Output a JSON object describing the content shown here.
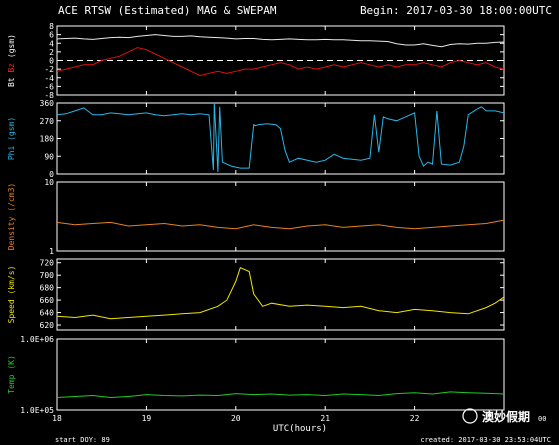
{
  "header": {
    "title": "ACE RTSW (Estimated) MAG & SWEPAM",
    "begin": "Begin: 2017-03-30 18:00:00UTC"
  },
  "footer": {
    "start": "start DOY: 89",
    "created": "created: 2017-03-30 23:53:04UTC",
    "xlabel": "UTC(hours)"
  },
  "watermark": {
    "text": "澳妙假期",
    "suffix": "00"
  },
  "chart_data": [
    {
      "type": "line",
      "panel": "mag",
      "ylabel_parts": [
        {
          "text": "Bt",
          "color": "#ffffff"
        },
        {
          "text": "Bz",
          "color": "#ff2020"
        },
        {
          "text": "(gsm)",
          "color": "#ffffff"
        }
      ],
      "yticks": [
        "-8",
        "-6",
        "-4",
        "-2",
        "0",
        "2",
        "4",
        "6",
        "8"
      ],
      "ylim": [
        -8,
        8
      ],
      "zero_line": "dashed",
      "x": [
        18.0,
        18.1,
        18.2,
        18.3,
        18.4,
        18.5,
        18.6,
        18.7,
        18.8,
        18.9,
        19.0,
        19.1,
        19.2,
        19.3,
        19.4,
        19.5,
        19.6,
        19.7,
        19.8,
        19.9,
        20.0,
        20.1,
        20.2,
        20.3,
        20.4,
        20.5,
        20.6,
        20.7,
        20.8,
        20.9,
        21.0,
        21.1,
        21.2,
        21.3,
        21.4,
        21.5,
        21.6,
        21.7,
        21.8,
        21.9,
        22.0,
        22.1,
        22.2,
        22.3,
        22.4,
        22.5,
        22.6,
        22.7,
        22.8,
        22.9,
        23.0
      ],
      "series": [
        {
          "name": "Bt",
          "color": "#e8e8e8",
          "values": [
            5.0,
            5.1,
            5.2,
            5.0,
            4.9,
            5.1,
            5.3,
            5.4,
            5.3,
            5.6,
            5.8,
            6.0,
            5.8,
            5.6,
            5.6,
            5.7,
            5.5,
            5.4,
            5.3,
            5.2,
            5.0,
            5.1,
            5.1,
            4.9,
            4.8,
            4.9,
            5.0,
            4.9,
            4.8,
            4.8,
            4.9,
            4.8,
            4.8,
            4.7,
            4.6,
            4.6,
            4.5,
            4.4,
            3.9,
            3.6,
            3.6,
            3.9,
            3.5,
            3.2,
            3.7,
            3.9,
            3.8,
            4.0,
            4.0,
            4.2,
            4.3
          ]
        },
        {
          "name": "Bz",
          "color": "#e01010",
          "values": [
            -2.5,
            -2.0,
            -1.5,
            -1.0,
            -1.0,
            0.0,
            0.5,
            1.0,
            2.0,
            3.0,
            2.5,
            1.5,
            0.5,
            -0.5,
            -1.5,
            -2.5,
            -3.5,
            -3.0,
            -2.5,
            -3.0,
            -2.5,
            -2.0,
            -2.0,
            -1.5,
            -1.0,
            -0.5,
            -1.0,
            -2.0,
            -1.5,
            -2.0,
            -1.5,
            -1.0,
            -1.5,
            -1.0,
            -0.5,
            -1.0,
            -1.5,
            -1.0,
            -1.5,
            -1.0,
            -1.0,
            -0.5,
            -1.0,
            -1.5,
            -0.5,
            0.0,
            -0.5,
            -1.0,
            -0.5,
            -1.5,
            -2.0
          ]
        }
      ]
    },
    {
      "type": "line",
      "panel": "phi",
      "ylabel_parts": [
        {
          "text": "Phi (gsm)",
          "color": "#29b6e8"
        }
      ],
      "yticks": [
        "0",
        "90",
        "180",
        "270",
        "360"
      ],
      "ylim": [
        0,
        360
      ],
      "x": [
        18.0,
        18.1,
        18.2,
        18.3,
        18.4,
        18.5,
        18.6,
        18.7,
        18.8,
        18.9,
        19.0,
        19.1,
        19.2,
        19.3,
        19.4,
        19.5,
        19.6,
        19.7,
        19.75,
        19.76,
        19.8,
        19.82,
        19.85,
        19.95,
        20.05,
        20.15,
        20.2,
        20.22,
        20.25,
        20.35,
        20.45,
        20.5,
        20.55,
        20.6,
        20.7,
        20.8,
        20.9,
        21.0,
        21.1,
        21.2,
        21.3,
        21.4,
        21.5,
        21.55,
        21.6,
        21.65,
        21.7,
        21.8,
        21.9,
        22.0,
        22.05,
        22.1,
        22.15,
        22.2,
        22.25,
        22.3,
        22.4,
        22.5,
        22.55,
        22.6,
        22.7,
        22.75,
        22.8,
        22.9,
        23.0
      ],
      "series": [
        {
          "name": "Phi",
          "color": "#29b6e8",
          "values": [
            300,
            305,
            320,
            335,
            300,
            300,
            310,
            305,
            300,
            305,
            310,
            300,
            295,
            300,
            305,
            300,
            305,
            300,
            20,
            360,
            10,
            340,
            60,
            40,
            30,
            30,
            250,
            245,
            250,
            255,
            250,
            230,
            120,
            60,
            80,
            70,
            60,
            70,
            100,
            80,
            75,
            70,
            80,
            300,
            110,
            290,
            280,
            270,
            290,
            310,
            90,
            40,
            60,
            50,
            320,
            50,
            45,
            60,
            140,
            300,
            330,
            340,
            320,
            320,
            310
          ]
        }
      ]
    },
    {
      "type": "line",
      "panel": "density",
      "ylabel_parts": [
        {
          "text": "Density (/cm3)",
          "color": "#e8821e"
        }
      ],
      "yticks": [
        "1",
        "10"
      ],
      "yscale": "log",
      "ylim": [
        1,
        10
      ],
      "x": [
        18.0,
        18.2,
        18.4,
        18.6,
        18.8,
        19.0,
        19.2,
        19.4,
        19.6,
        19.8,
        20.0,
        20.2,
        20.4,
        20.6,
        20.8,
        21.0,
        21.2,
        21.4,
        21.6,
        21.8,
        22.0,
        22.2,
        22.4,
        22.6,
        22.8,
        23.0
      ],
      "series": [
        {
          "name": "Density",
          "color": "#e8821e",
          "values": [
            2.6,
            2.4,
            2.5,
            2.6,
            2.3,
            2.4,
            2.5,
            2.3,
            2.4,
            2.2,
            2.1,
            2.4,
            2.2,
            2.1,
            2.3,
            2.4,
            2.2,
            2.3,
            2.4,
            2.2,
            2.1,
            2.2,
            2.3,
            2.4,
            2.5,
            2.8
          ]
        }
      ]
    },
    {
      "type": "line",
      "panel": "speed",
      "ylabel_parts": [
        {
          "text": "Speed (km/s)",
          "color": "#f2e600"
        }
      ],
      "yticks": [
        "620",
        "640",
        "660",
        "680",
        "700",
        "720"
      ],
      "ylim": [
        612,
        726
      ],
      "x": [
        18.0,
        18.2,
        18.4,
        18.6,
        18.8,
        19.0,
        19.2,
        19.4,
        19.6,
        19.8,
        19.9,
        20.0,
        20.05,
        20.15,
        20.2,
        20.3,
        20.4,
        20.6,
        20.8,
        21.0,
        21.2,
        21.4,
        21.6,
        21.8,
        22.0,
        22.2,
        22.4,
        22.6,
        22.8,
        22.9,
        23.0
      ],
      "series": [
        {
          "name": "Speed",
          "color": "#f2e600",
          "values": [
            634,
            632,
            636,
            630,
            632,
            634,
            636,
            638,
            640,
            650,
            660,
            690,
            712,
            706,
            670,
            650,
            655,
            650,
            652,
            650,
            648,
            650,
            643,
            640,
            645,
            643,
            640,
            638,
            648,
            655,
            665
          ]
        }
      ]
    },
    {
      "type": "line",
      "panel": "temp",
      "ylabel_parts": [
        {
          "text": "Temp (K)",
          "color": "#22cc22"
        }
      ],
      "yticks": [
        "1.0E+05",
        "1.0E+06"
      ],
      "yscale": "log",
      "ylim": [
        100000,
        1000000
      ],
      "x": [
        18.0,
        18.2,
        18.4,
        18.6,
        18.8,
        19.0,
        19.2,
        19.4,
        19.6,
        19.8,
        20.0,
        20.2,
        20.4,
        20.6,
        20.8,
        21.0,
        21.2,
        21.4,
        21.6,
        21.8,
        22.0,
        22.2,
        22.4,
        22.6,
        22.8,
        23.0
      ],
      "series": [
        {
          "name": "Temp",
          "color": "#22cc22",
          "values": [
            150000,
            155000,
            160000,
            150000,
            155000,
            165000,
            160000,
            158000,
            162000,
            160000,
            170000,
            165000,
            168000,
            162000,
            165000,
            160000,
            168000,
            165000,
            160000,
            170000,
            175000,
            168000,
            180000,
            175000,
            172000,
            168000
          ]
        }
      ]
    }
  ],
  "x_axis": {
    "ticks": [
      "18",
      "19",
      "20",
      "21",
      "22"
    ],
    "tick_values": [
      18,
      19,
      20,
      21,
      22
    ],
    "range": [
      18,
      23
    ]
  }
}
